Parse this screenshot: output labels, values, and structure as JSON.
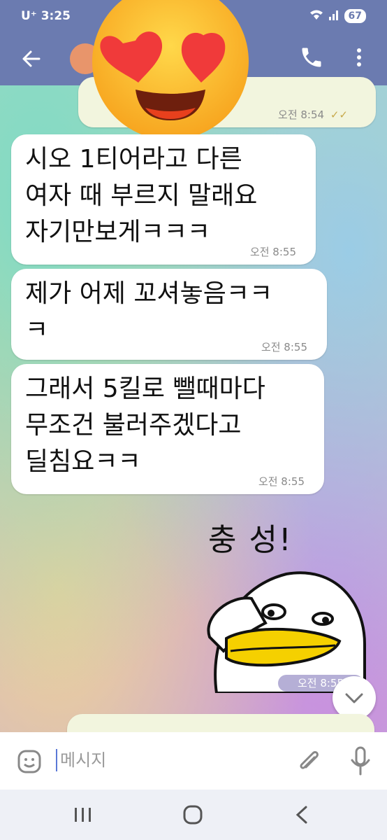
{
  "status_bar": {
    "carrier": "U⁺",
    "time": "3:25",
    "battery": "67"
  },
  "header": {
    "back_icon": "arrow-left-icon",
    "call_icon": "phone-icon",
    "menu_icon": "kebab-icon"
  },
  "messages": [
    {
      "direction": "outgoing",
      "text": "",
      "time": "오전 8:54"
    },
    {
      "direction": "incoming",
      "lines": [
        "시오 1티어라고 다른",
        "여자 때 부르지 말래요",
        "자기만보게ㅋㅋㅋ"
      ],
      "time": "오전 8:55"
    },
    {
      "direction": "incoming",
      "lines": [
        "제가 어제 꼬셔놓음ㅋㅋ",
        "ㅋ"
      ],
      "time": "오전 8:55"
    },
    {
      "direction": "incoming",
      "lines": [
        "그래서 5킬로 뺄때마다",
        "무조건 불러주겠다고",
        "딜침요ㅋㅋ"
      ],
      "time": "오전 8:55"
    }
  ],
  "sticker": {
    "caption": "충 성!",
    "time": "오전 8:55"
  },
  "input": {
    "placeholder": "메시지"
  },
  "colors": {
    "header": "#6b7bb0",
    "bubble_in": "#ffffff",
    "bubble_out": "#f2f5de"
  }
}
